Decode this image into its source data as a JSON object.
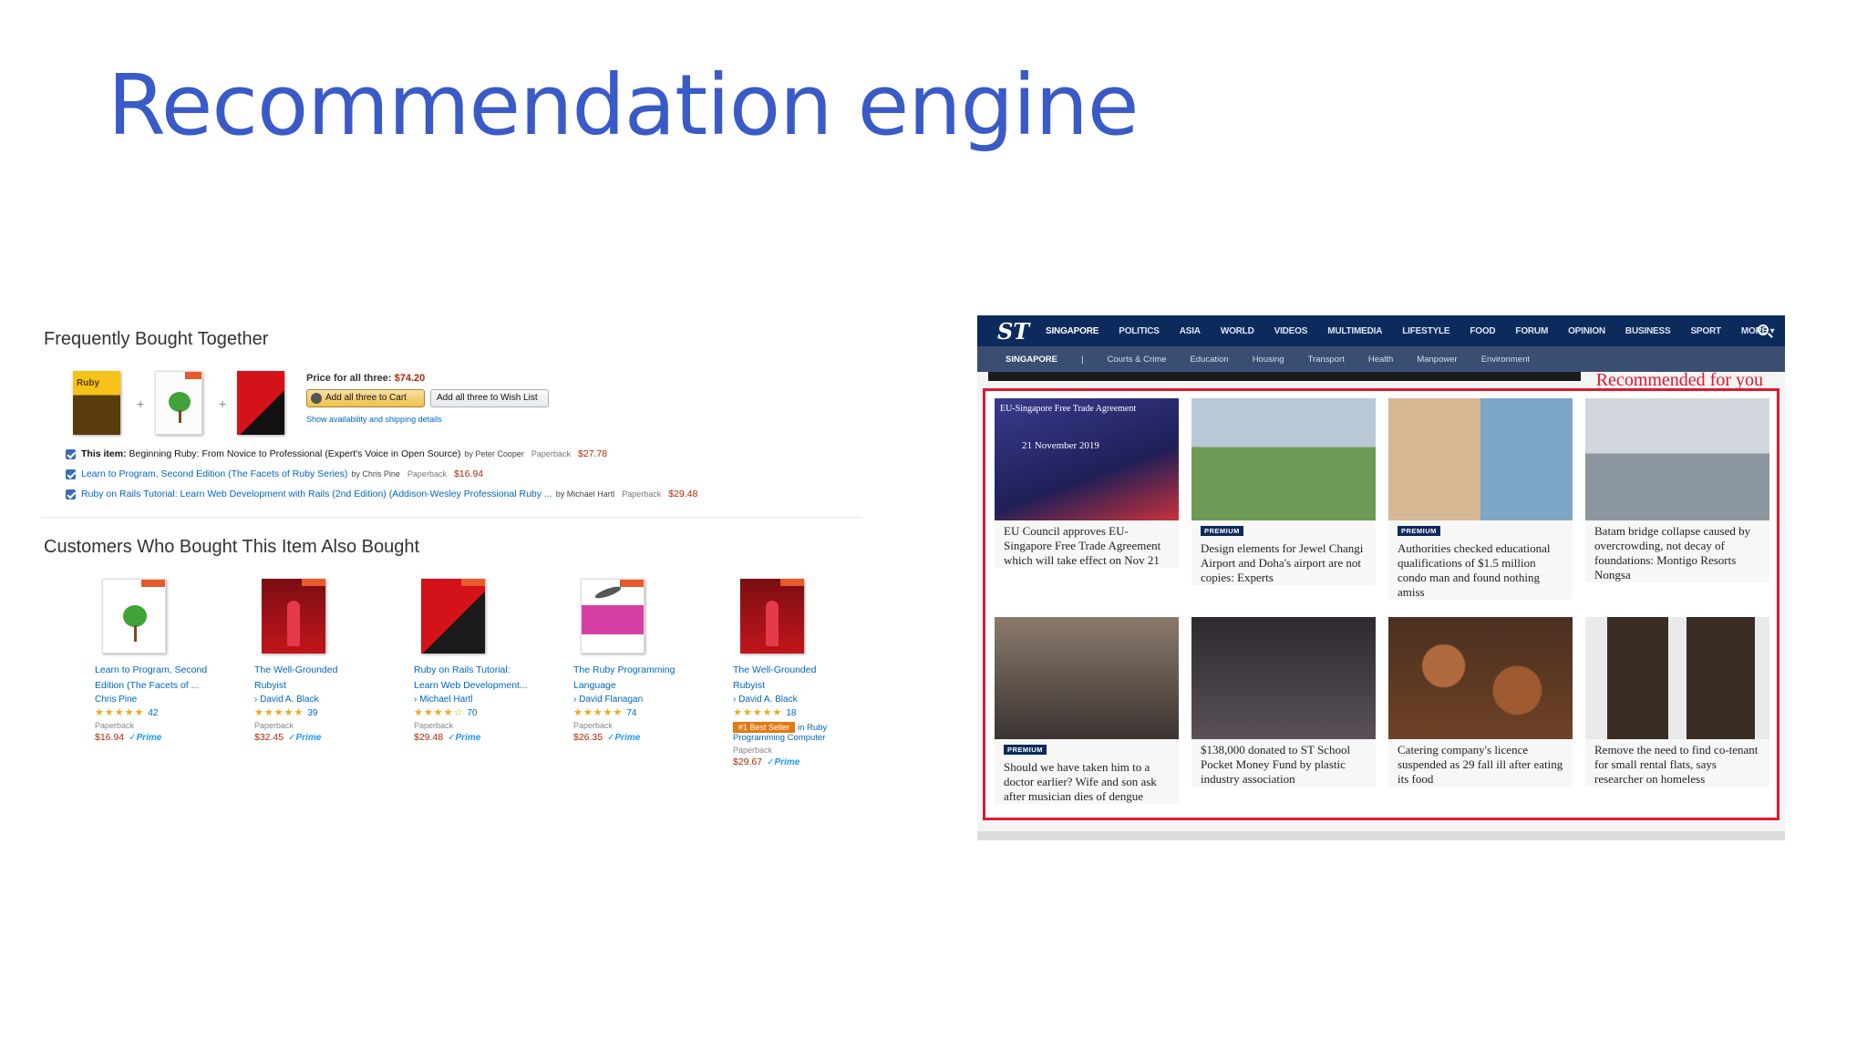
{
  "slide": {
    "title": "Recommendation engine"
  },
  "amazon": {
    "fbt_title": "Frequently Bought Together",
    "price_label": "Price for all three:",
    "price_value": "$74.20",
    "add_cart_label": "Add all three to Cart",
    "add_wishlist_label": "Add all three to Wish List",
    "shipping_link": "Show availability and shipping details",
    "items": [
      {
        "prefix": "This item:",
        "title": "Beginning Ruby: From Novice to Professional (Expert's Voice in Open Source)",
        "by": "by Peter Cooper",
        "format": "Paperback",
        "price": "$27.78"
      },
      {
        "prefix": "",
        "title": "Learn to Program, Second Edition (The Facets of Ruby Series)",
        "by": "by Chris Pine",
        "format": "Paperback",
        "price": "$16.94"
      },
      {
        "prefix": "",
        "title": "Ruby on Rails Tutorial: Learn Web Development with Rails (2nd Edition) (Addison-Wesley Professional Ruby ...",
        "by": "by Michael Hartl",
        "format": "Paperback",
        "price": "$29.48"
      }
    ],
    "cwb_title": "Customers Who Bought This Item Also Bought",
    "also_bought": [
      {
        "title_1": "Learn to Program, Second",
        "title_2": "Edition (The Facets of ...",
        "author": "Chris Pine",
        "stars": "★★★★★",
        "reviews": "42",
        "format": "Paperback",
        "price": "$16.94",
        "prime": "✓Prime",
        "badge": "",
        "badge_in": "",
        "badge_in_2": ""
      },
      {
        "title_1": "The Well-Grounded",
        "title_2": "Rubyist",
        "author": "› David A. Black",
        "stars": "★★★★★",
        "reviews": "39",
        "format": "Paperback",
        "price": "$32.45",
        "prime": "✓Prime",
        "badge": "",
        "badge_in": "",
        "badge_in_2": ""
      },
      {
        "title_1": "Ruby on Rails Tutorial:",
        "title_2": "Learn Web Development...",
        "author": "› Michael Hartl",
        "stars": "★★★★☆",
        "reviews": "70",
        "format": "Paperback",
        "price": "$29.48",
        "prime": "✓Prime",
        "badge": "",
        "badge_in": "",
        "badge_in_2": ""
      },
      {
        "title_1": "The Ruby Programming",
        "title_2": "Language",
        "author": "› David Flanagan",
        "stars": "★★★★★",
        "reviews": "74",
        "format": "Paperback",
        "price": "$26.35",
        "prime": "✓Prime",
        "badge": "",
        "badge_in": "",
        "badge_in_2": ""
      },
      {
        "title_1": "The Well-Grounded",
        "title_2": "Rubyist",
        "author": "› David A. Black",
        "stars": "★★★★★",
        "reviews": "18",
        "format": "Paperback",
        "price": "$29.67",
        "prime": "✓Prime",
        "badge": "#1 Best Seller",
        "badge_in": "in Ruby",
        "badge_in_2": "Programming Computer"
      }
    ]
  },
  "straits_times": {
    "logo": "ST",
    "nav": [
      "SINGAPORE",
      "POLITICS",
      "ASIA",
      "WORLD",
      "VIDEOS",
      "MULTIMEDIA",
      "LIFESTYLE",
      "FOOD",
      "FORUM",
      "OPINION",
      "BUSINESS",
      "SPORT",
      "MORE ▾"
    ],
    "subnav": [
      "SINGAPORE",
      "|",
      "Courts & Crime",
      "Education",
      "Housing",
      "Transport",
      "Health",
      "Manpower",
      "Environment"
    ],
    "reco_label": "Recommended for you",
    "premium_label": "PREMIUM",
    "articles": [
      {
        "premium": false,
        "headline": "EU Council approves EU-Singapore Free Trade Agreement which will take effect on Nov 21",
        "img_caption": "EU-Singapore Free Trade Agreement",
        "img_date": "21 November 2019"
      },
      {
        "premium": true,
        "headline": "Design elements for Jewel Changi Airport and Doha's airport are not copies: Experts",
        "img_caption": "",
        "img_date": ""
      },
      {
        "premium": true,
        "headline": "Authorities checked educational qualifications of $1.5 million condo man and found nothing amiss",
        "img_caption": "",
        "img_date": ""
      },
      {
        "premium": false,
        "headline": "Batam bridge collapse caused by overcrowding, not decay of foundations: Montigo Resorts Nongsa",
        "img_caption": "",
        "img_date": ""
      },
      {
        "premium": true,
        "headline": "Should we have taken him to a doctor earlier? Wife and son ask after musician dies of dengue",
        "img_caption": "",
        "img_date": ""
      },
      {
        "premium": false,
        "headline": "$138,000 donated to ST School Pocket Money Fund by plastic industry association",
        "img_caption": "",
        "img_date": ""
      },
      {
        "premium": false,
        "headline": "Catering company's licence suspended as 29 fall ill after eating its food",
        "img_caption": "",
        "img_date": ""
      },
      {
        "premium": false,
        "headline": "Remove the need to find co-tenant for small rental flats, says researcher on homeless",
        "img_caption": "",
        "img_date": ""
      }
    ]
  }
}
